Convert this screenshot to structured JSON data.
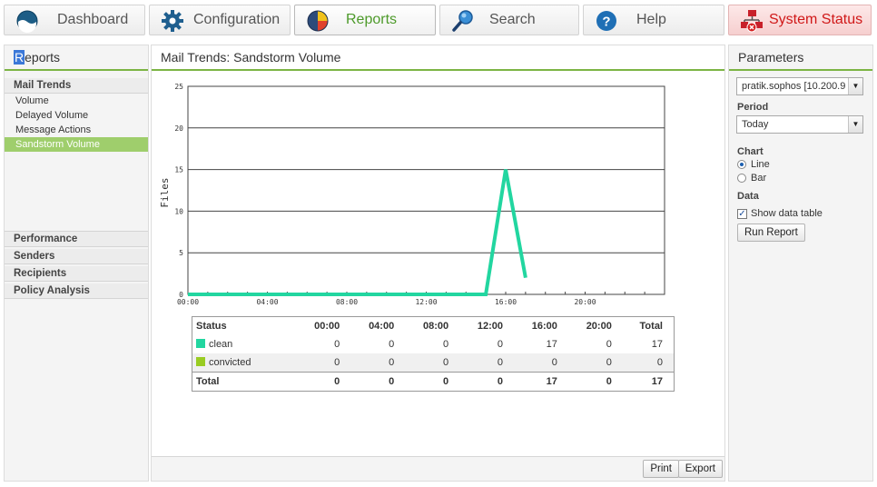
{
  "tabs": [
    {
      "label": "Dashboard",
      "icon": "dashboard-icon"
    },
    {
      "label": "Configuration",
      "icon": "gear-icon"
    },
    {
      "label": "Reports",
      "icon": "reports-icon"
    },
    {
      "label": "Search",
      "icon": "search-icon"
    },
    {
      "label": "Help",
      "icon": "help-icon"
    },
    {
      "label": "System Status",
      "icon": "system-status-icon"
    }
  ],
  "left": {
    "title_first": "R",
    "title_rest": "eports",
    "groups": [
      {
        "label": "Mail Trends",
        "items": [
          "Volume",
          "Delayed Volume",
          "Message Actions",
          "Sandstorm Volume"
        ]
      }
    ],
    "selected_item": "Sandstorm Volume",
    "other_groups": [
      "Performance",
      "Senders",
      "Recipients",
      "Policy Analysis"
    ]
  },
  "center": {
    "title": "Mail Trends: Sandstorm Volume",
    "print_label": "Print",
    "export_label": "Export"
  },
  "chart_data": {
    "type": "line",
    "title": "",
    "ylabel": "Files",
    "xlabel": "",
    "ylim": [
      0,
      25
    ],
    "yticks": [
      0,
      5,
      10,
      15,
      20,
      25
    ],
    "xlim": [
      0,
      24
    ],
    "xticks": [
      0,
      4,
      8,
      12,
      16,
      20
    ],
    "xtick_labels": [
      "00:00",
      "04:00",
      "08:00",
      "12:00",
      "16:00",
      "20:00"
    ],
    "grid": true,
    "series": [
      {
        "name": "clean",
        "color": "#22d6a0",
        "points": [
          [
            0,
            0
          ],
          [
            1,
            0
          ],
          [
            2,
            0
          ],
          [
            3,
            0
          ],
          [
            4,
            0
          ],
          [
            5,
            0
          ],
          [
            6,
            0
          ],
          [
            7,
            0
          ],
          [
            8,
            0
          ],
          [
            9,
            0
          ],
          [
            10,
            0
          ],
          [
            11,
            0
          ],
          [
            12,
            0
          ],
          [
            13,
            0
          ],
          [
            14,
            0
          ],
          [
            15,
            0
          ],
          [
            16,
            15
          ],
          [
            17,
            2
          ]
        ]
      }
    ]
  },
  "table": {
    "headers": [
      "Status",
      "00:00",
      "04:00",
      "08:00",
      "12:00",
      "16:00",
      "20:00",
      "Total"
    ],
    "rows": [
      {
        "status": "clean",
        "color": "#22d6a0",
        "values": [
          "0",
          "0",
          "0",
          "0",
          "17",
          "0",
          "17"
        ]
      },
      {
        "status": "convicted",
        "color": "#99cc22",
        "values": [
          "0",
          "0",
          "0",
          "0",
          "0",
          "0",
          "0"
        ]
      }
    ],
    "total": {
      "label": "Total",
      "values": [
        "0",
        "0",
        "0",
        "0",
        "17",
        "0",
        "17"
      ]
    }
  },
  "params": {
    "title": "Parameters",
    "host_value": "pratik.sophos [10.200.9",
    "period_label": "Period",
    "period_value": "Today",
    "chart_label": "Chart",
    "chart_line_label": "Line",
    "chart_bar_label": "Bar",
    "chart_selected": "Line",
    "data_label": "Data",
    "show_table_label": "Show data table",
    "show_table_checked": true,
    "run_label": "Run Report"
  }
}
